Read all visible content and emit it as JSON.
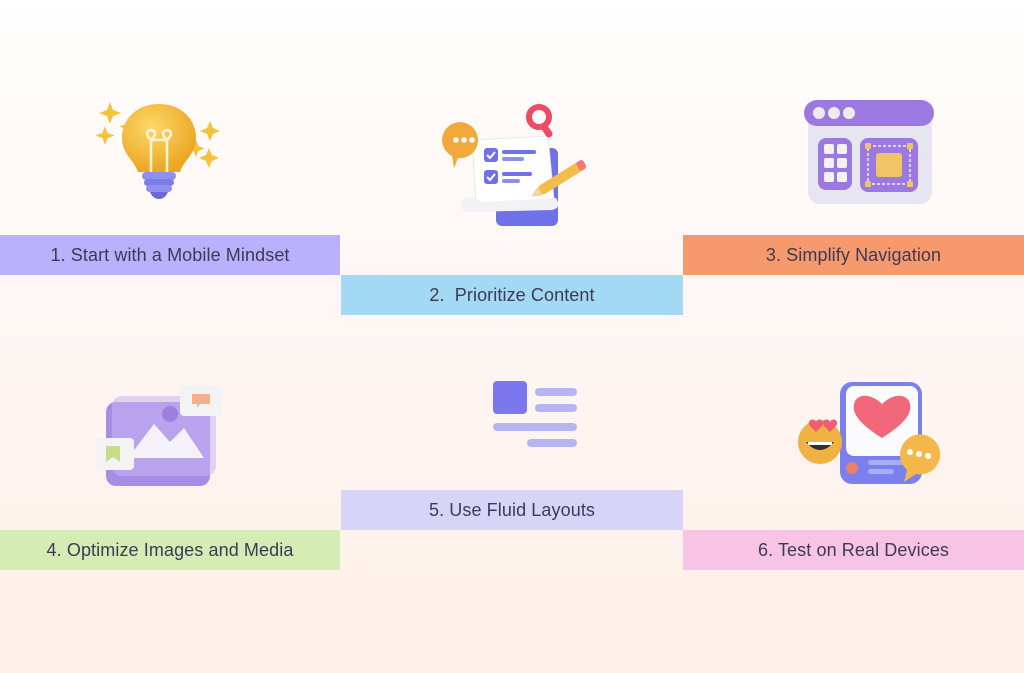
{
  "steps": [
    {
      "number": 1,
      "label": "1. Start with a Mobile Mindset",
      "color": "#bbb0fb",
      "icon": "lightbulb-icon"
    },
    {
      "number": 2,
      "label": "2.  Prioritize Content",
      "color": "#a3d9f5",
      "icon": "checklist-document-icon"
    },
    {
      "number": 3,
      "label": "3. Simplify Navigation",
      "color": "#f69a6d",
      "icon": "browser-window-layout-icon"
    },
    {
      "number": 4,
      "label": "4. Optimize Images and Media",
      "color": "#d5ecb4",
      "icon": "image-gallery-icon"
    },
    {
      "number": 5,
      "label": "5. Use Fluid Layouts",
      "color": "#d8d4f7",
      "icon": "fluid-layout-icon"
    },
    {
      "number": 6,
      "label": "6. Test on Real Devices",
      "color": "#f8c4e6",
      "icon": "phone-heart-icon"
    }
  ]
}
